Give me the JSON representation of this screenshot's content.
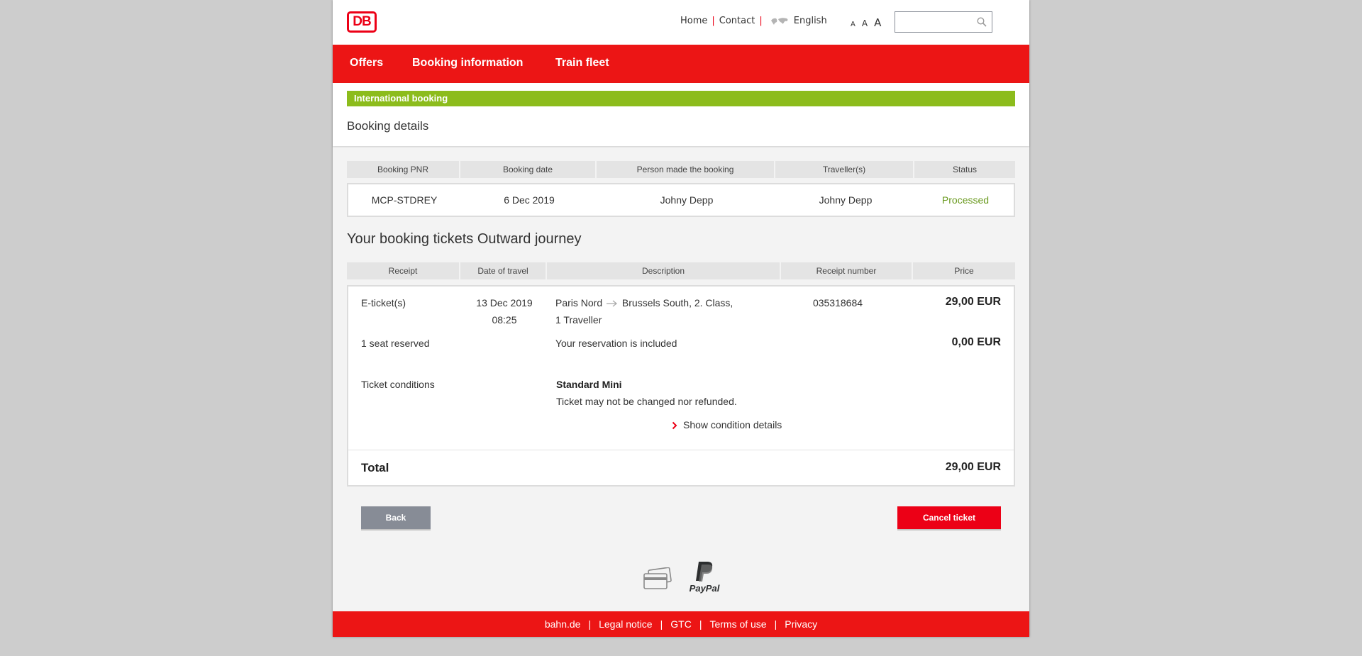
{
  "header": {
    "logo": "DB",
    "links": [
      "Home",
      "Contact"
    ],
    "language": "English",
    "font_sizes": [
      "A",
      "A",
      "A"
    ],
    "search_value": ""
  },
  "nav": {
    "items": [
      "Offers",
      "Booking information",
      "Train fleet"
    ]
  },
  "banner": "International booking",
  "page_title": "Booking details",
  "booking_table": {
    "headers": [
      "Booking PNR",
      "Booking date",
      "Person made the booking",
      "Traveller(s)",
      "Status"
    ],
    "row": {
      "pnr": "MCP-STDREY",
      "date": "6 Dec 2019",
      "person": "Johny Depp",
      "travellers": "Johny Depp",
      "status": "Processed"
    }
  },
  "tickets_title": "Your booking tickets Outward journey",
  "tickets_table": {
    "headers": [
      "Receipt",
      "Date of travel",
      "Description",
      "Receipt number",
      "Price"
    ],
    "eticket": {
      "receipt": "E-ticket(s)",
      "date": "13 Dec 2019",
      "time": "08:25",
      "from": "Paris Nord",
      "to": "Brussels South, 2. Class,",
      "travellers": "1 Traveller",
      "receipt_number": "035318684",
      "price": "29,00 EUR"
    },
    "seat": {
      "receipt": "1 seat reserved",
      "description": "Your reservation is included",
      "price": "0,00 EUR"
    },
    "conditions": {
      "label": "Ticket conditions",
      "name": "Standard Mini",
      "text": "Ticket may not be changed nor refunded.",
      "link": "Show condition details"
    },
    "total": {
      "label": "Total",
      "price": "29,00 EUR"
    }
  },
  "buttons": {
    "back": "Back",
    "cancel": "Cancel ticket"
  },
  "payment": {
    "paypal": "PayPal"
  },
  "footer": {
    "links": [
      "bahn.de",
      "Legal notice",
      "GTC",
      "Terms of use",
      "Privacy"
    ]
  },
  "colors": {
    "brand_red": "#ec1515",
    "green": "#8cbc1c",
    "status_green": "#6a9a1f",
    "back_gray": "#878c96"
  }
}
